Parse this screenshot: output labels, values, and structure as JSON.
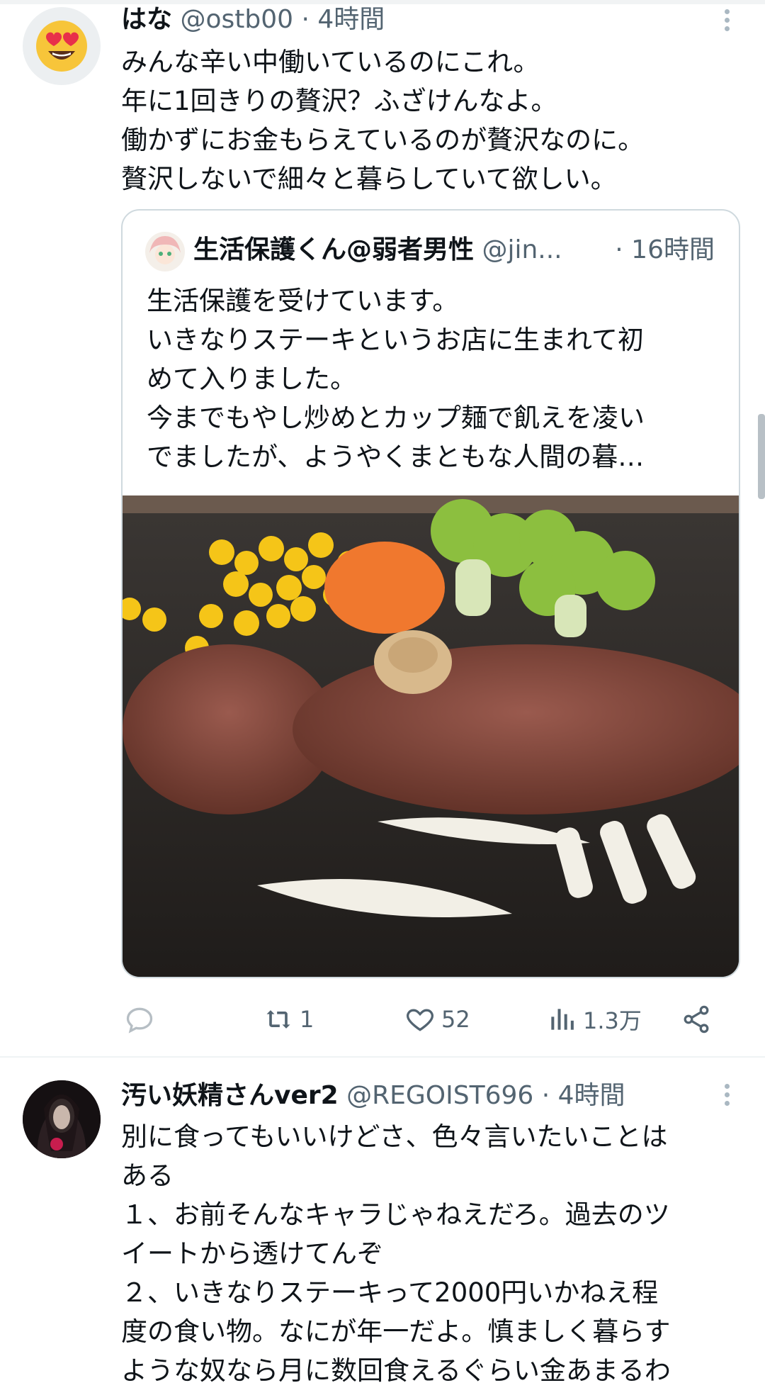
{
  "tweet1": {
    "name": "はな",
    "handle": "@ostb00",
    "time": "· 4時間",
    "text": "みんな辛い中働いているのにこれ。\n年に1回きりの贅沢？ふざけんなよ。\n働かずにお金もらえているのが贅沢なのに。\n贅沢しないで細々と暮らしていて欲しい。",
    "avatar_icon": "heart-eyes-emoji-icon",
    "more_icon": "more-vertical-icon"
  },
  "quote": {
    "name": "生活保護くん@弱者男性",
    "handle": "@jin...",
    "time": "· 16時間",
    "text": "生活保護を受けています。\nいきなりステーキというお店に生まれて初\nめて入りました。\n今までもやし炒めとカップ麺で飢えを凌い\nでましたが、ようやくまともな人間の暮…",
    "image_icon": "steak-photo"
  },
  "actions": {
    "reply_icon": "reply-icon",
    "reply_count": "",
    "retweet_icon": "retweet-icon",
    "retweet_count": "1",
    "like_icon": "heart-icon",
    "like_count": "52",
    "views_icon": "views-icon",
    "views_count": "1.3万",
    "share_icon": "share-icon"
  },
  "tweet2": {
    "name": "汚い妖精さんver2",
    "handle": "@REGOIST696",
    "time": "· 4時間",
    "text": "別に食ってもいいけどさ、色々言いたいことは\nある\n１、お前そんなキャラじゃねえだろ。過去のツ\nイートから透けてんぞ\n２、いきなりステーキって2000円いかねえ程\n度の食い物。なにが年一だよ。慎ましく暮らす\nような奴なら月に数回食えるぐらい金あまるわ",
    "more_icon": "more-vertical-icon"
  },
  "colors": {
    "text": "#0f1419",
    "secondary": "#536471",
    "border": "#cfd9de"
  }
}
